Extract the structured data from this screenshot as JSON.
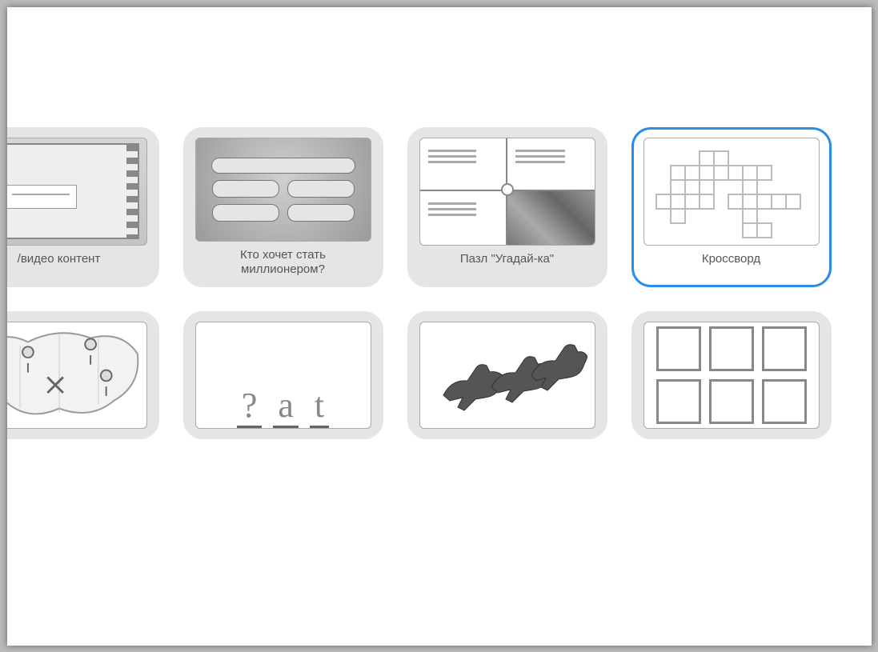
{
  "cards": {
    "row1": [
      {
        "id": "video",
        "label": "/видео контент",
        "selected": false
      },
      {
        "id": "millionaire",
        "label": "Кто хочет стать миллионером?",
        "selected": false
      },
      {
        "id": "puzzle",
        "label": "Пазл \"Угадай-ка\"",
        "selected": false
      },
      {
        "id": "crossword",
        "label": "Кроссворд",
        "selected": true
      }
    ],
    "row2": [
      {
        "id": "map",
        "label": ""
      },
      {
        "id": "letters",
        "label": ""
      },
      {
        "id": "horse",
        "label": ""
      },
      {
        "id": "grid",
        "label": ""
      }
    ]
  },
  "letters_thumb": {
    "chars": [
      "?",
      "a",
      "t"
    ]
  },
  "colors": {
    "selection_border": "#2a8de8",
    "card_bg": "#e5e5e5"
  }
}
